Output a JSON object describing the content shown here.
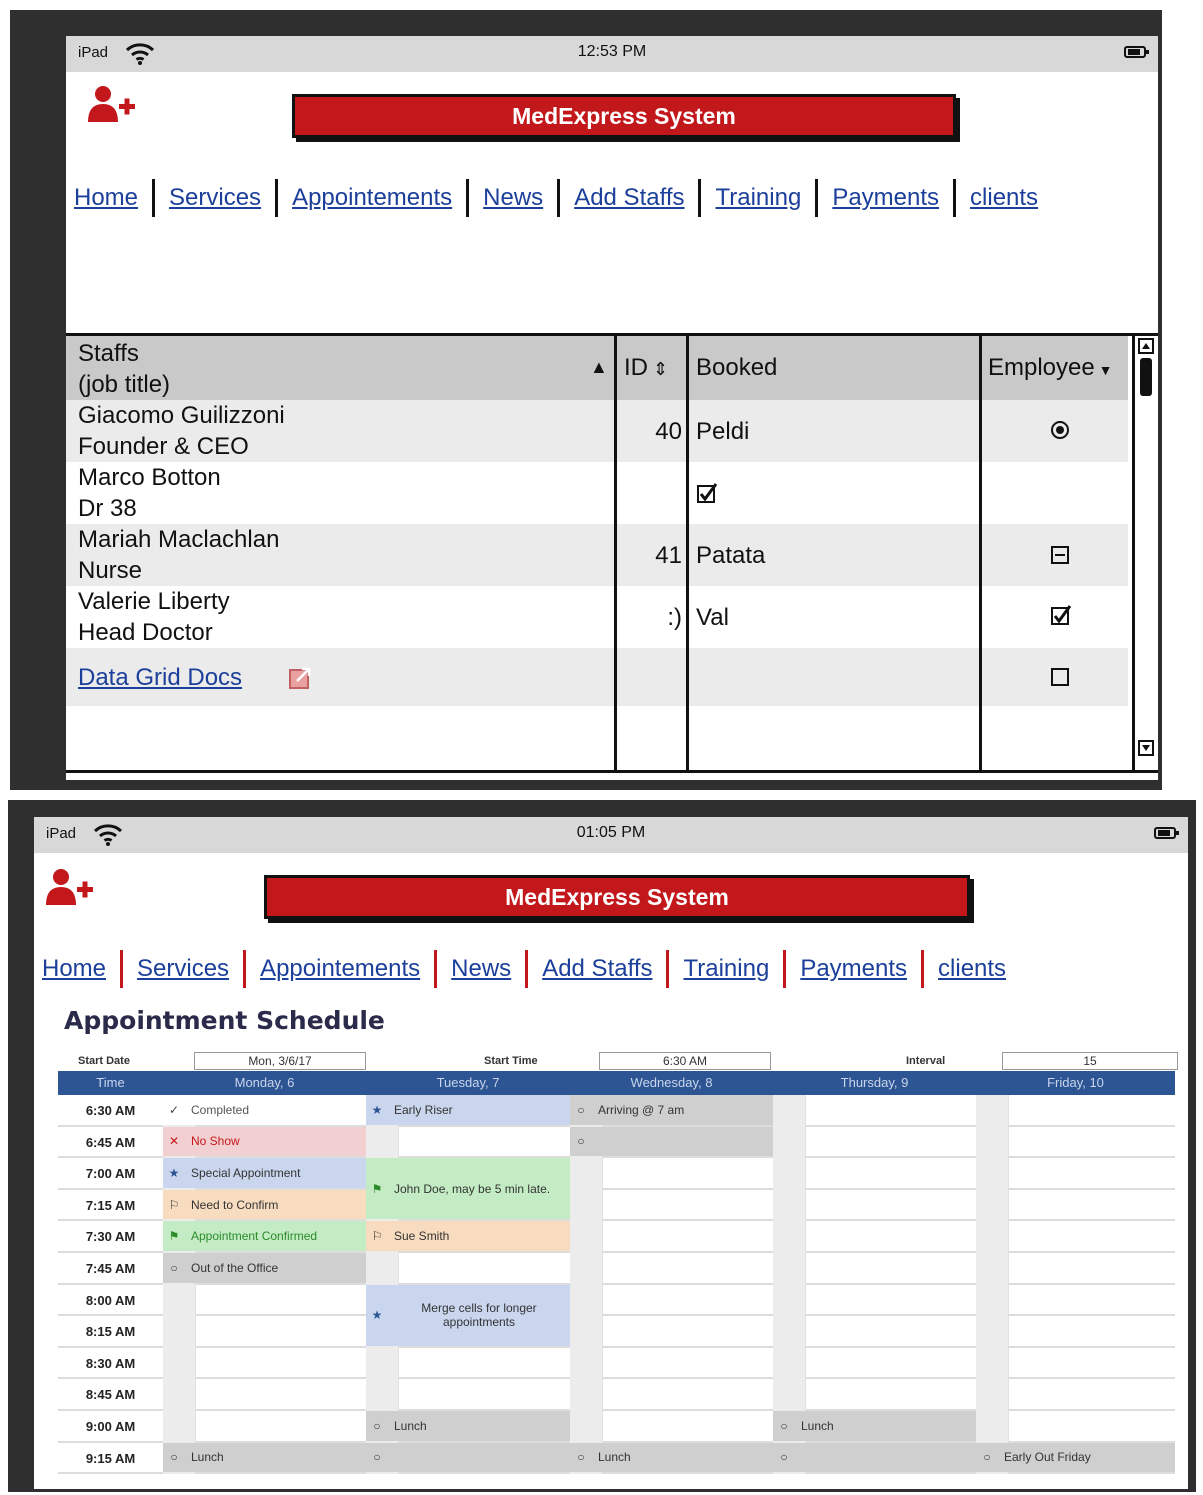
{
  "screen1": {
    "status": {
      "carrier": "iPad",
      "time": "12:53 PM"
    },
    "title": "MedExpress System",
    "nav": [
      "Home",
      "Services",
      "Appointements",
      "News",
      "Add Staffs",
      "Training",
      "Payments",
      "clients"
    ],
    "grid": {
      "headers": {
        "staff_line1": "Staffs",
        "staff_line2": "(job title)",
        "id": "ID",
        "booked": "Booked",
        "employee": "Employee"
      },
      "rows": [
        {
          "name": "Giacomo Guilizzoni",
          "title": "Founder & CEO",
          "id": "40",
          "booked": "Peldi",
          "employee": "radio-selected"
        },
        {
          "name": "Marco Botton",
          "title": "Dr 38",
          "id": "",
          "booked": "checkbox-checked",
          "employee": ""
        },
        {
          "name": "Mariah Maclachlan",
          "title": "Nurse",
          "id": "41",
          "booked": "Patata",
          "employee": "checkbox-indeterminate"
        },
        {
          "name": "Valerie Liberty",
          "title": "Head Doctor",
          "id": ":)",
          "booked": "Val",
          "employee": "checkbox-checked"
        }
      ],
      "link": "Data Grid Docs"
    }
  },
  "screen2": {
    "status": {
      "carrier": "iPad",
      "time": "01:05 PM"
    },
    "title": "MedExpress System",
    "nav": [
      "Home",
      "Services",
      "Appointements",
      "News",
      "Add Staffs",
      "Training",
      "Payments",
      "clients"
    ],
    "schedule": {
      "title": "Appointment Schedule",
      "start_date_label": "Start Date",
      "start_date": "Mon, 3/6/17",
      "start_time_label": "Start Time",
      "start_time": "6:30 AM",
      "interval_label": "Interval",
      "interval": "15",
      "columns": [
        "Time",
        "Monday, 6",
        "Tuesday, 7",
        "Wednesday, 8",
        "Thursday, 9",
        "Friday, 10"
      ],
      "times": [
        "6:30 AM",
        "6:45 AM",
        "7:00 AM",
        "7:15 AM",
        "7:30 AM",
        "7:45 AM",
        "8:00 AM",
        "8:15 AM",
        "8:30 AM",
        "8:45 AM",
        "9:00 AM",
        "9:15 AM"
      ],
      "events": {
        "completed": "Completed",
        "no_show": "No Show",
        "special": "Special Appointment",
        "need_confirm": "Need to Confirm",
        "confirmed": "Appointment Confirmed",
        "out_of_office": "Out of the Office",
        "early_riser": "Early Riser",
        "john_doe": "John Doe, may be 5 min late.",
        "sue_smith": "Sue Smith",
        "merge": "Merge cells for longer appointments",
        "lunch": "Lunch",
        "arriving": "Arriving @ 7 am",
        "early_out": "Early Out Friday"
      }
    }
  },
  "colors": {
    "brand_red": "#c3181b",
    "link_blue": "#1b3f9a",
    "header_blue": "#2d5593"
  }
}
